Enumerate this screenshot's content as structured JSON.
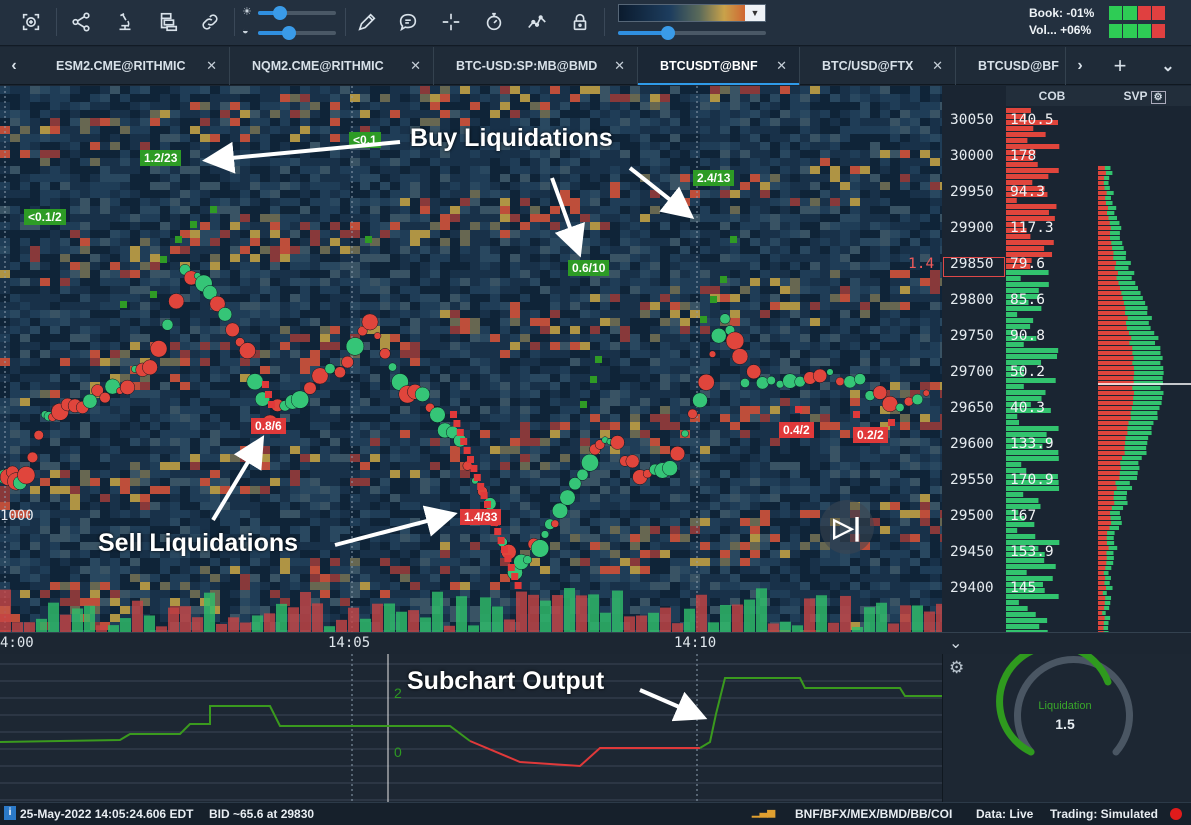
{
  "toolbar": {
    "icons": [
      "add-indicator-icon",
      "share-icon",
      "microscope-icon",
      "layers-icon",
      "link-icon",
      "pencil-icon",
      "chat-icon",
      "crosshair-icon",
      "stopwatch-icon",
      "line-chart-icon",
      "lock-icon"
    ],
    "book_label": "Book: -01%",
    "vol_label": "Vol... +06%",
    "book_colors": [
      "#2ecc55",
      "#2ecc55",
      "#e04040",
      "#e04040"
    ],
    "vol_colors": [
      "#2ecc55",
      "#2ecc55",
      "#2ecc55",
      "#e04040"
    ],
    "slider1_pct": 0.28,
    "slider2_pct": 0.4,
    "slider3_pct": 0.34
  },
  "tabs": [
    {
      "label": "ESM2.CME@RITHMIC",
      "close": "✕"
    },
    {
      "label": "NQM2.CME@RITHMIC",
      "close": "✕"
    },
    {
      "label": "BTC-USD:SP:MB@BMD",
      "close": "✕"
    },
    {
      "label": "BTCUSDT@BNF",
      "close": "✕",
      "active": true
    },
    {
      "label": "BTC/USD@FTX",
      "close": "✕"
    },
    {
      "label": "BTCUSD@BF",
      "close": ""
    }
  ],
  "chart": {
    "cob_header": "COB",
    "svp_header": "SVP",
    "prices": [
      "30050",
      "30000",
      "29950",
      "29900",
      "29850",
      "29800",
      "29750",
      "29700",
      "29650",
      "29600",
      "29550",
      "29500",
      "29450",
      "29400"
    ],
    "cob_values": [
      "140.5",
      "178",
      "94.3",
      "117.3",
      "79.6",
      "85.6",
      "90.8",
      "50.2",
      "40.3",
      "133.9",
      "170.9",
      "167",
      "153.9",
      "145"
    ],
    "current_marker": "1.4",
    "left_level": "1000",
    "time_labels": [
      "4:00",
      "14:05",
      "14:10"
    ],
    "buy_labels": [
      "1.2/23",
      "<0.1",
      "<0.1/2",
      "0.6/10",
      "2.4/13"
    ],
    "sell_labels": [
      "0.8/6",
      "1.4/33",
      "0.4/2",
      "0.2/2"
    ],
    "annotations": {
      "buy": "Buy Liquidations",
      "sell": "Sell Liquidations",
      "sub": "Subchart Output"
    }
  },
  "subchart": {
    "levels": [
      "2",
      "0"
    ],
    "gauge_label": "Liquidation",
    "gauge_value": "1.5"
  },
  "status": {
    "datetime": "25-May-2022 14:05:24.606 EDT",
    "bid": "BID ~65.6 at 29830",
    "exchanges": "BNF/BFX/MEX/BMD/BB/COI",
    "data": "Data: Live",
    "trading": "Trading: Simulated"
  }
}
